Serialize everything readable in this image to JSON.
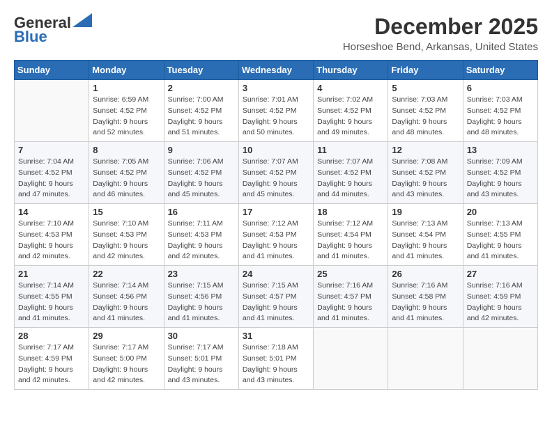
{
  "logo": {
    "line1": "General",
    "line2": "Blue"
  },
  "title": "December 2025",
  "subtitle": "Horseshoe Bend, Arkansas, United States",
  "weekdays": [
    "Sunday",
    "Monday",
    "Tuesday",
    "Wednesday",
    "Thursday",
    "Friday",
    "Saturday"
  ],
  "weeks": [
    [
      {
        "day": "",
        "info": ""
      },
      {
        "day": "1",
        "info": "Sunrise: 6:59 AM\nSunset: 4:52 PM\nDaylight: 9 hours\nand 52 minutes."
      },
      {
        "day": "2",
        "info": "Sunrise: 7:00 AM\nSunset: 4:52 PM\nDaylight: 9 hours\nand 51 minutes."
      },
      {
        "day": "3",
        "info": "Sunrise: 7:01 AM\nSunset: 4:52 PM\nDaylight: 9 hours\nand 50 minutes."
      },
      {
        "day": "4",
        "info": "Sunrise: 7:02 AM\nSunset: 4:52 PM\nDaylight: 9 hours\nand 49 minutes."
      },
      {
        "day": "5",
        "info": "Sunrise: 7:03 AM\nSunset: 4:52 PM\nDaylight: 9 hours\nand 48 minutes."
      },
      {
        "day": "6",
        "info": "Sunrise: 7:03 AM\nSunset: 4:52 PM\nDaylight: 9 hours\nand 48 minutes."
      }
    ],
    [
      {
        "day": "7",
        "info": "Sunrise: 7:04 AM\nSunset: 4:52 PM\nDaylight: 9 hours\nand 47 minutes."
      },
      {
        "day": "8",
        "info": "Sunrise: 7:05 AM\nSunset: 4:52 PM\nDaylight: 9 hours\nand 46 minutes."
      },
      {
        "day": "9",
        "info": "Sunrise: 7:06 AM\nSunset: 4:52 PM\nDaylight: 9 hours\nand 45 minutes."
      },
      {
        "day": "10",
        "info": "Sunrise: 7:07 AM\nSunset: 4:52 PM\nDaylight: 9 hours\nand 45 minutes."
      },
      {
        "day": "11",
        "info": "Sunrise: 7:07 AM\nSunset: 4:52 PM\nDaylight: 9 hours\nand 44 minutes."
      },
      {
        "day": "12",
        "info": "Sunrise: 7:08 AM\nSunset: 4:52 PM\nDaylight: 9 hours\nand 43 minutes."
      },
      {
        "day": "13",
        "info": "Sunrise: 7:09 AM\nSunset: 4:52 PM\nDaylight: 9 hours\nand 43 minutes."
      }
    ],
    [
      {
        "day": "14",
        "info": "Sunrise: 7:10 AM\nSunset: 4:53 PM\nDaylight: 9 hours\nand 42 minutes."
      },
      {
        "day": "15",
        "info": "Sunrise: 7:10 AM\nSunset: 4:53 PM\nDaylight: 9 hours\nand 42 minutes."
      },
      {
        "day": "16",
        "info": "Sunrise: 7:11 AM\nSunset: 4:53 PM\nDaylight: 9 hours\nand 42 minutes."
      },
      {
        "day": "17",
        "info": "Sunrise: 7:12 AM\nSunset: 4:53 PM\nDaylight: 9 hours\nand 41 minutes."
      },
      {
        "day": "18",
        "info": "Sunrise: 7:12 AM\nSunset: 4:54 PM\nDaylight: 9 hours\nand 41 minutes."
      },
      {
        "day": "19",
        "info": "Sunrise: 7:13 AM\nSunset: 4:54 PM\nDaylight: 9 hours\nand 41 minutes."
      },
      {
        "day": "20",
        "info": "Sunrise: 7:13 AM\nSunset: 4:55 PM\nDaylight: 9 hours\nand 41 minutes."
      }
    ],
    [
      {
        "day": "21",
        "info": "Sunrise: 7:14 AM\nSunset: 4:55 PM\nDaylight: 9 hours\nand 41 minutes."
      },
      {
        "day": "22",
        "info": "Sunrise: 7:14 AM\nSunset: 4:56 PM\nDaylight: 9 hours\nand 41 minutes."
      },
      {
        "day": "23",
        "info": "Sunrise: 7:15 AM\nSunset: 4:56 PM\nDaylight: 9 hours\nand 41 minutes."
      },
      {
        "day": "24",
        "info": "Sunrise: 7:15 AM\nSunset: 4:57 PM\nDaylight: 9 hours\nand 41 minutes."
      },
      {
        "day": "25",
        "info": "Sunrise: 7:16 AM\nSunset: 4:57 PM\nDaylight: 9 hours\nand 41 minutes."
      },
      {
        "day": "26",
        "info": "Sunrise: 7:16 AM\nSunset: 4:58 PM\nDaylight: 9 hours\nand 41 minutes."
      },
      {
        "day": "27",
        "info": "Sunrise: 7:16 AM\nSunset: 4:59 PM\nDaylight: 9 hours\nand 42 minutes."
      }
    ],
    [
      {
        "day": "28",
        "info": "Sunrise: 7:17 AM\nSunset: 4:59 PM\nDaylight: 9 hours\nand 42 minutes."
      },
      {
        "day": "29",
        "info": "Sunrise: 7:17 AM\nSunset: 5:00 PM\nDaylight: 9 hours\nand 42 minutes."
      },
      {
        "day": "30",
        "info": "Sunrise: 7:17 AM\nSunset: 5:01 PM\nDaylight: 9 hours\nand 43 minutes."
      },
      {
        "day": "31",
        "info": "Sunrise: 7:18 AM\nSunset: 5:01 PM\nDaylight: 9 hours\nand 43 minutes."
      },
      {
        "day": "",
        "info": ""
      },
      {
        "day": "",
        "info": ""
      },
      {
        "day": "",
        "info": ""
      }
    ]
  ]
}
